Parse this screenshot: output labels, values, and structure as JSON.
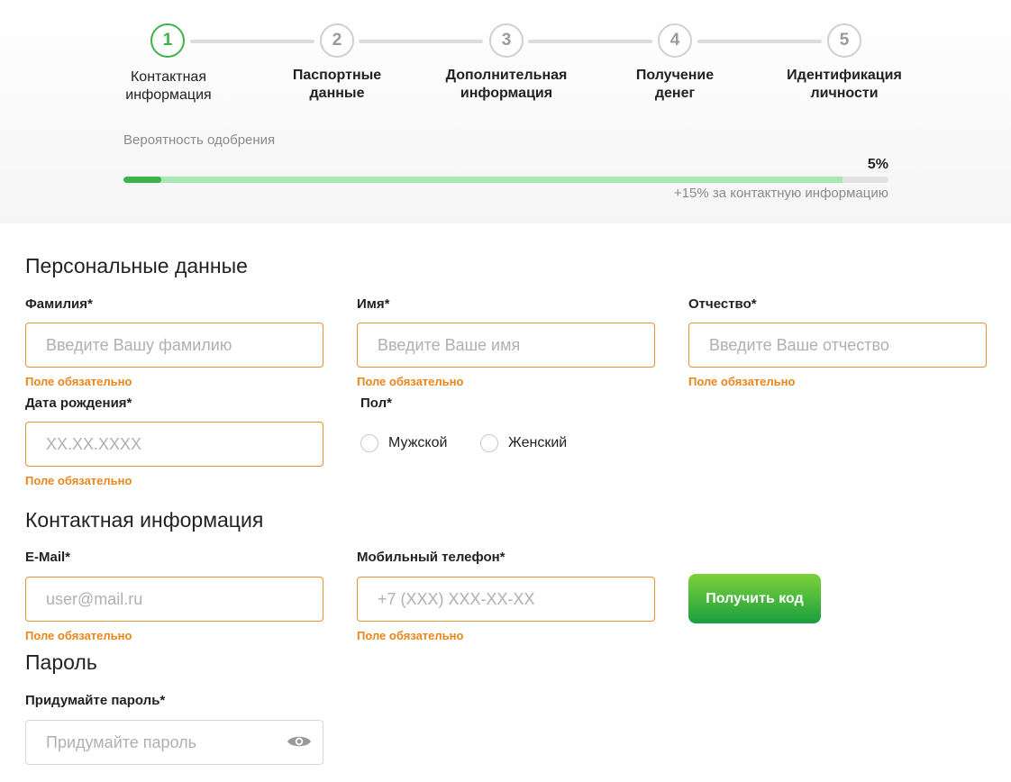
{
  "stepper": {
    "steps": [
      {
        "number": "1",
        "label": "Контактная\nинформация",
        "active": true
      },
      {
        "number": "2",
        "label": "Паспортные\nданные",
        "active": false
      },
      {
        "number": "3",
        "label": "Дополнительная\nинформация",
        "active": false
      },
      {
        "number": "4",
        "label": "Получение\nденег",
        "active": false
      },
      {
        "number": "5",
        "label": "Идентификация\nличности",
        "active": false
      }
    ]
  },
  "approval": {
    "label": "Вероятность одобрения",
    "value_text": "5%",
    "value_fraction": 0.05,
    "bonus_fraction": 0.94,
    "hint": "+15% за контактную информацию"
  },
  "personal": {
    "title": "Персональные данные",
    "lastname": {
      "label": "Фамилия*",
      "placeholder": "Введите Вашу фамилию",
      "error": "Поле обязательно"
    },
    "firstname": {
      "label": "Имя*",
      "placeholder": "Введите Ваше имя",
      "error": "Поле обязательно"
    },
    "patronymic": {
      "label": "Отчество*",
      "placeholder": "Введите Ваше отчество",
      "error": "Поле обязательно"
    },
    "birthdate": {
      "label": "Дата рождения*",
      "placeholder": "XX.XX.XXXX",
      "error": "Поле обязательно"
    },
    "gender": {
      "label": "Пол*",
      "options": [
        "Мужской",
        "Женский"
      ]
    }
  },
  "contact": {
    "title": "Контактная информация",
    "email": {
      "label": "E-Mail*",
      "placeholder": "user@mail.ru",
      "error": "Поле обязательно"
    },
    "phone": {
      "label": "Мобильный телефон*",
      "placeholder": "+7 (XXX) XXX-XX-XX",
      "error": "Поле обязательно"
    },
    "get_code_label": "Получить код"
  },
  "password": {
    "title": "Пароль",
    "label": "Придумайте пароль*",
    "placeholder": "Придумайте пароль"
  },
  "colors": {
    "accent_green": "#3cb24a",
    "error_orange": "#e8861c",
    "bonus_green": "#a8e8b4"
  }
}
